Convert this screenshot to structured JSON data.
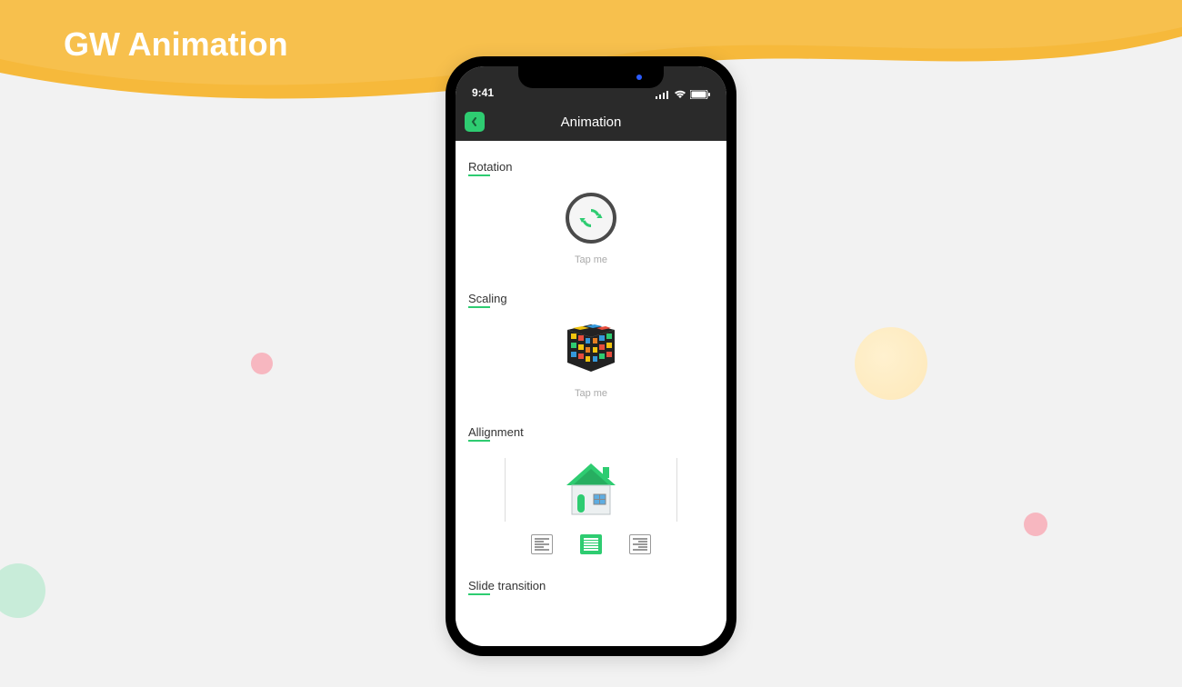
{
  "page_title": "GW Animation",
  "status_bar": {
    "time": "9:41"
  },
  "nav": {
    "title": "Animation"
  },
  "sections": {
    "rotation": {
      "title": "Rotation",
      "tap_label": "Tap me"
    },
    "scaling": {
      "title": "Scaling",
      "tap_label": "Tap me"
    },
    "alignment": {
      "title": "Allignment"
    },
    "slide": {
      "title": "Slide transition"
    }
  }
}
